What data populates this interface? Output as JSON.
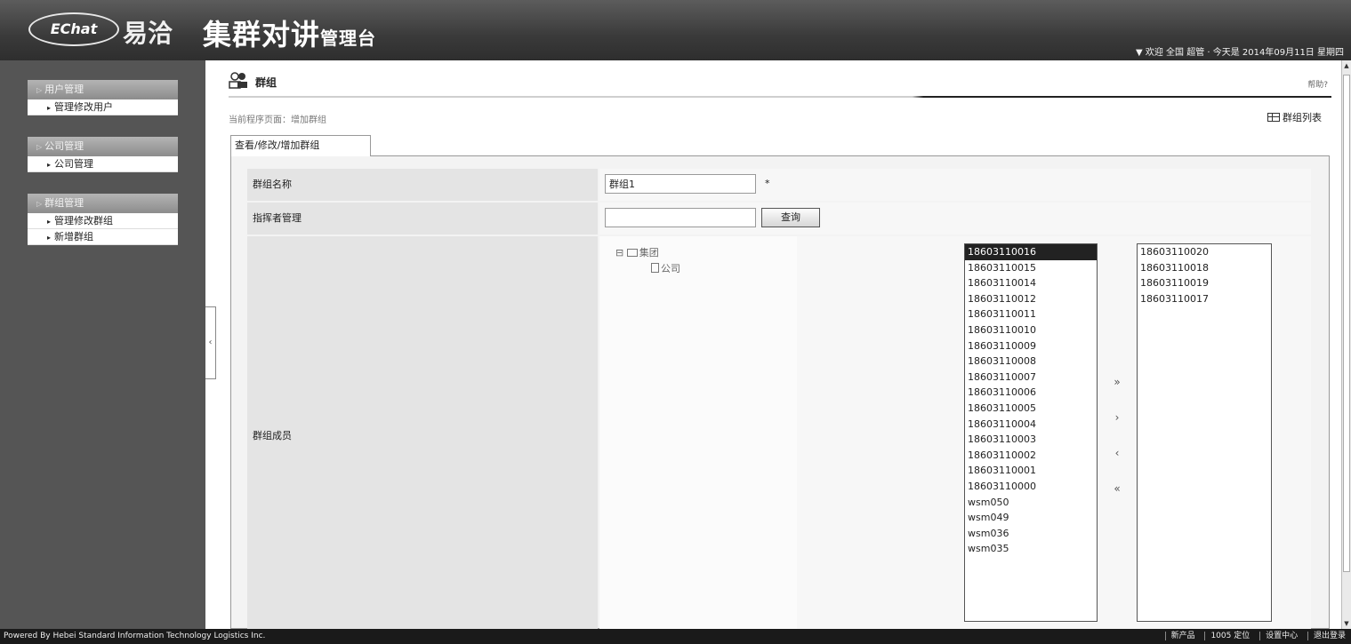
{
  "header": {
    "logo_text": "EChat",
    "logo_cn": "易洽",
    "app_title": "集群对讲",
    "app_title_sub": "管理台",
    "user_info": "▼ 欢迎 全国 超管 · 今天是 2014年09月11日 星期四"
  },
  "sidebar": {
    "groups": [
      {
        "title": "用户管理",
        "items": [
          "管理修改用户"
        ]
      },
      {
        "title": "公司管理",
        "items": [
          "公司管理"
        ]
      },
      {
        "title": "群组管理",
        "items": [
          "管理修改群组",
          "新增群组"
        ]
      }
    ]
  },
  "main": {
    "page_title": "群组",
    "help": "帮助?",
    "breadcrumb": "当前程序页面：增加群组",
    "group_list_link": "群组列表",
    "tab_label": "查看/修改/增加群组",
    "form": {
      "group_name_label": "群组名称",
      "group_name_value": "群组1",
      "required_mark": "*",
      "dispatcher_label": "指挥者管理",
      "query_button": "查询",
      "members_label": "群组成员"
    },
    "tree": {
      "root": "集团",
      "child": "公司"
    },
    "available_users": [
      "18603110016",
      "18603110015",
      "18603110014",
      "18603110012",
      "18603110011",
      "18603110010",
      "18603110009",
      "18603110008",
      "18603110007",
      "18603110006",
      "18603110005",
      "18603110004",
      "18603110003",
      "18603110002",
      "18603110001",
      "18603110000",
      "wsm050",
      "wsm049",
      "wsm036",
      "wsm035"
    ],
    "selected_users": [
      "18603110020",
      "18603110018",
      "18603110019",
      "18603110017"
    ],
    "move_buttons": {
      "add_all": "»",
      "add": "›",
      "remove": "‹",
      "remove_all": "«"
    }
  },
  "statusbar": {
    "powered_by": "Powered By Hebei Standard Information Technology Logistics Inc.",
    "items": [
      "新产品",
      "1005 定位",
      "设置中心",
      "退出登录"
    ]
  }
}
